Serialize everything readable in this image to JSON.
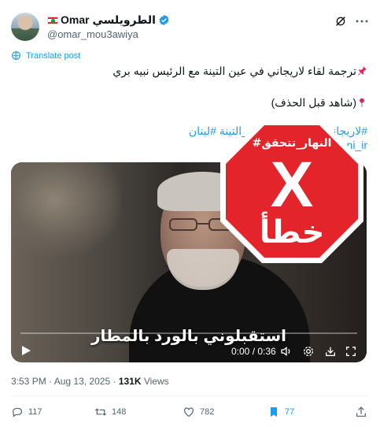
{
  "user": {
    "display_name": "الطرويلسي Omar",
    "handle": "@omar_mou3awiya",
    "flag": "lebanon-flag-icon",
    "verified_color": "#1d9bf0"
  },
  "post": {
    "translate_label": "Translate post",
    "line1": "ترجمة لقاء لاريجاني في عين التينة مع الرئيس نبيه بري",
    "line2": "(شاهد قبل الحذف)",
    "hashtags": "#لاريجاني #نبيه_بري #عين_التينة #لبنان",
    "hashtags_tail": "ani_ir"
  },
  "video": {
    "subtitle": "استقبلوني بالورد بالمطار",
    "time": "0:00 / 0:36",
    "progress": 0
  },
  "stamp": {
    "banner": "#النهار_تتحقق",
    "mark": "X",
    "word": "خطأ",
    "color": "#e3242b"
  },
  "meta": {
    "time": "3:53 PM",
    "date": "Aug 13, 2025",
    "views_count": "131K",
    "views_label": "Views"
  },
  "actions": {
    "replies": "117",
    "reposts": "148",
    "likes": "782",
    "bookmarks": "77"
  },
  "colors": {
    "link": "#1d9bf0",
    "muted": "#536471",
    "text": "#0f1419"
  }
}
